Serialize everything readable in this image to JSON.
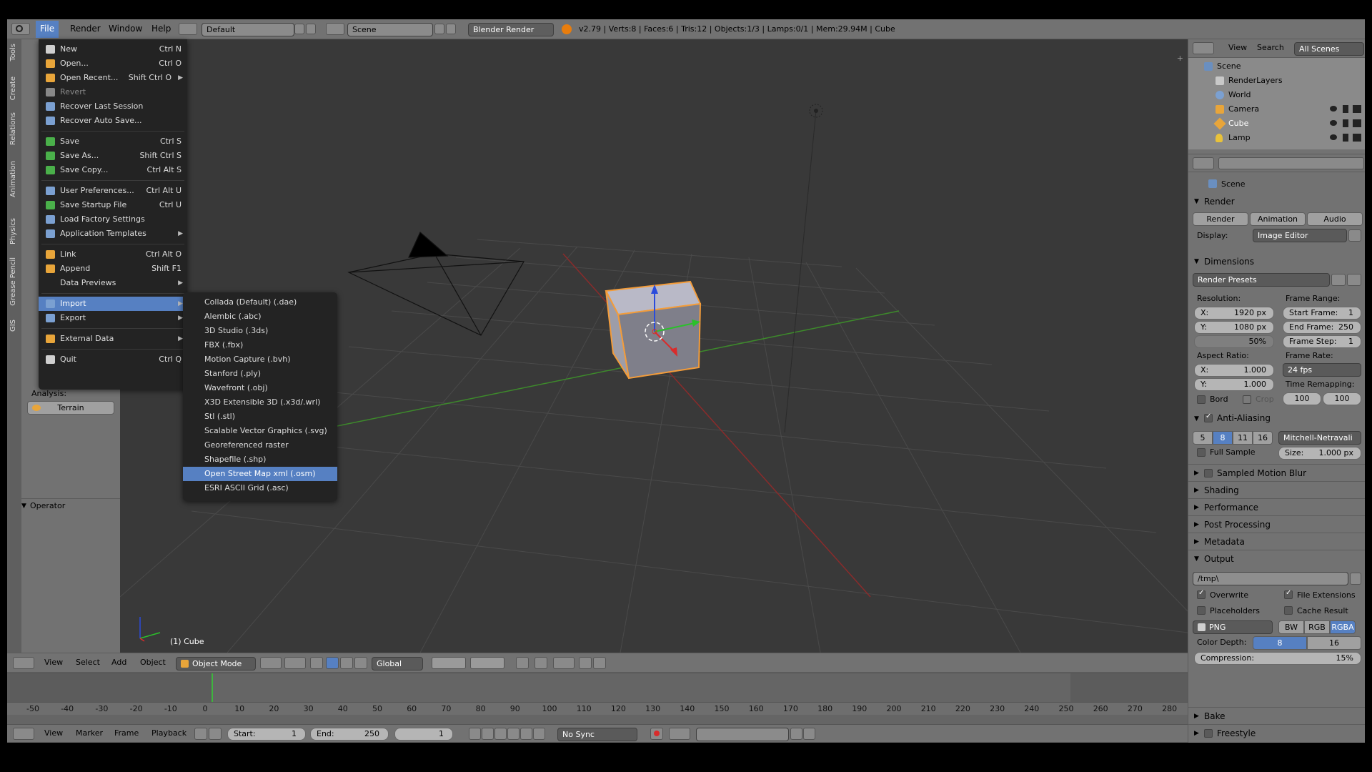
{
  "top_menu": {
    "items": [
      "File",
      "Render",
      "Window",
      "Help"
    ],
    "layout_name": "Default",
    "scene_name": "Scene",
    "engine": "Blender Render",
    "stats": "v2.79 | Verts:8 | Faces:6 | Tris:12 | Objects:1/3 | Lamps:0/1 | Mem:29.94M | Cube"
  },
  "file_menu": {
    "items": [
      {
        "label": "New",
        "shortcut": "Ctrl N",
        "enabled": true
      },
      {
        "label": "Open...",
        "shortcut": "Ctrl O",
        "enabled": true
      },
      {
        "label": "Open Recent...",
        "shortcut": "Shift Ctrl O",
        "enabled": true
      },
      {
        "label": "Revert",
        "shortcut": "",
        "enabled": false
      },
      {
        "label": "Recover Last Session",
        "shortcut": "",
        "enabled": true
      },
      {
        "label": "Recover Auto Save...",
        "shortcut": "",
        "enabled": true
      },
      {
        "label": "Save",
        "shortcut": "Ctrl S",
        "enabled": true
      },
      {
        "label": "Save As...",
        "shortcut": "Shift Ctrl S",
        "enabled": true
      },
      {
        "label": "Save Copy...",
        "shortcut": "Ctrl Alt S",
        "enabled": true
      },
      {
        "label": "User Preferences...",
        "shortcut": "Ctrl Alt U",
        "enabled": true
      },
      {
        "label": "Save Startup File",
        "shortcut": "Ctrl U",
        "enabled": true
      },
      {
        "label": "Load Factory Settings",
        "shortcut": "",
        "enabled": true
      },
      {
        "label": "Application Templates",
        "shortcut": "",
        "enabled": true
      },
      {
        "label": "Link",
        "shortcut": "Ctrl Alt O",
        "enabled": true
      },
      {
        "label": "Append",
        "shortcut": "Shift F1",
        "enabled": true
      },
      {
        "label": "Data Previews",
        "shortcut": "",
        "enabled": true
      },
      {
        "label": "Import",
        "shortcut": "",
        "enabled": true
      },
      {
        "label": "Export",
        "shortcut": "",
        "enabled": true
      },
      {
        "label": "External Data",
        "shortcut": "",
        "enabled": true
      },
      {
        "label": "Quit",
        "shortcut": "Ctrl Q",
        "enabled": true
      }
    ]
  },
  "import_menu": {
    "items": [
      "Collada (Default) (.dae)",
      "Alembic (.abc)",
      "3D Studio (.3ds)",
      "FBX (.fbx)",
      "Motion Capture (.bvh)",
      "Stanford (.ply)",
      "Wavefront (.obj)",
      "X3D Extensible 3D (.x3d/.wrl)",
      "Stl (.stl)",
      "Scalable Vector Graphics (.svg)",
      "Georeferenced raster",
      "Shapefile (.shp)",
      "Open Street Map xml (.osm)",
      "ESRI ASCII Grid (.asc)"
    ],
    "selected": "Open Street Map xml (.osm)"
  },
  "left_panel": {
    "tabs": [
      "Tools",
      "Create",
      "Relations",
      "Animation",
      "Physics",
      "Grease Pencil",
      "GIS"
    ],
    "analysis_label": "Analysis:",
    "terrain_button": "Terrain",
    "operator_label": "Operator"
  },
  "viewport": {
    "object_label": "(1) Cube",
    "header": {
      "menus": [
        "View",
        "Select",
        "Add",
        "Object"
      ],
      "mode": "Object Mode",
      "orientation": "Global"
    }
  },
  "timeline": {
    "ticks": [
      "-50",
      "-40",
      "-30",
      "-20",
      "-10",
      "0",
      "10",
      "20",
      "30",
      "40",
      "50",
      "60",
      "70",
      "80",
      "90",
      "100",
      "110",
      "120",
      "130",
      "140",
      "150",
      "160",
      "170",
      "180",
      "190",
      "200",
      "210",
      "220",
      "230",
      "240",
      "250",
      "260",
      "270",
      "280"
    ],
    "menus": [
      "View",
      "Marker",
      "Frame",
      "Playback"
    ],
    "start_label": "Start:",
    "start": "1",
    "end_label": "End:",
    "end": "250",
    "current": "1",
    "sync": "No Sync"
  },
  "outliner": {
    "menus": [
      "View",
      "Search"
    ],
    "filter": "All Scenes",
    "items": [
      "Scene",
      "RenderLayers",
      "World",
      "Camera",
      "Cube",
      "Lamp"
    ]
  },
  "properties": {
    "context": "Scene",
    "render_header": "Render",
    "render_buttons": [
      "Render",
      "Animation",
      "Audio"
    ],
    "display_label": "Display:",
    "display_value": "Image Editor",
    "dimensions_header": "Dimensions",
    "presets": "Render Presets",
    "resolution_label": "Resolution:",
    "res_x": "X:",
    "res_x_val": "1920 px",
    "res_y": "Y:",
    "res_y_val": "1080 px",
    "res_pct": "50%",
    "frame_range_label": "Frame Range:",
    "start_frame": "Start Frame:",
    "start_frame_val": "1",
    "end_frame": "End Frame:",
    "end_frame_val": "250",
    "frame_step": "Frame Step:",
    "frame_step_val": "1",
    "aspect_label": "Aspect Ratio:",
    "aspect_x": "X:",
    "aspect_x_val": "1.000",
    "aspect_y": "Y:",
    "aspect_y_val": "1.000",
    "frame_rate_label": "Frame Rate:",
    "frame_rate": "24 fps",
    "time_remap_label": "Time Remapping:",
    "remap_old": "100",
    "remap_new": "100",
    "bord": "Bord",
    "crop": "Crop",
    "aa_header": "Anti-Aliasing",
    "aa_samples": [
      "5",
      "8",
      "11",
      "16"
    ],
    "aa_selected": "8",
    "aa_filter": "Mitchell-Netravali",
    "full_sample": "Full Sample",
    "size_label": "Size:",
    "size_val": "1.000 px",
    "collapsed": [
      "Sampled Motion Blur",
      "Shading",
      "Performance",
      "Post Processing",
      "Metadata"
    ],
    "output_header": "Output",
    "output_path": "/tmp\\",
    "overwrite": "Overwrite",
    "file_ext": "File Extensions",
    "placeholders": "Placeholders",
    "cache_result": "Cache Result",
    "format": "PNG",
    "color_modes": [
      "BW",
      "RGB",
      "RGBA"
    ],
    "color_depth_label": "Color Depth:",
    "depth_8": "8",
    "depth_16": "16",
    "compression_label": "Compression:",
    "compression": "15%",
    "bake": "Bake",
    "freestyle": "Freestyle"
  },
  "colors": {
    "selection": "#5680c2",
    "viewport_bg": "#393939",
    "panel_bg": "#727272"
  }
}
